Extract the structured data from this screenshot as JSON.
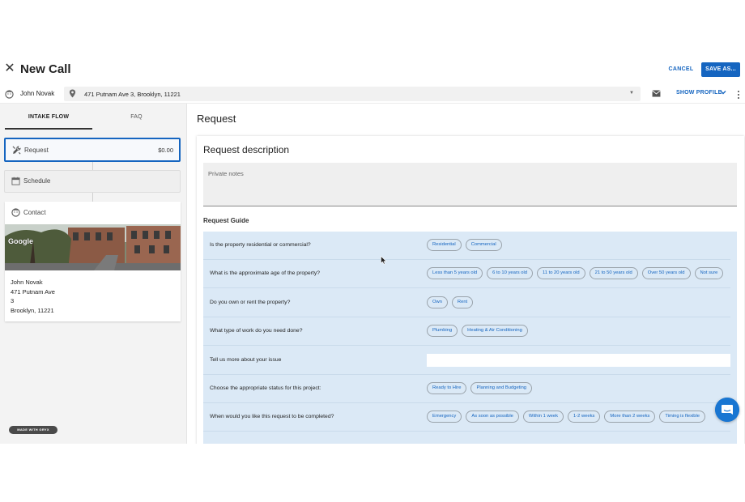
{
  "header": {
    "title": "New Call",
    "cancel_label": "CANCEL",
    "save_label": "SAVE AS..."
  },
  "topbar": {
    "customer_name": "John Novak",
    "address": "471 Putnam Ave 3, Brooklyn, 11221",
    "show_profile_label": "SHOW PROFILE"
  },
  "sidebar": {
    "tabs": [
      "INTAKE FLOW",
      "FAQ"
    ],
    "steps": [
      {
        "label": "Request",
        "amount": "$0.00",
        "icon": "tools-icon"
      },
      {
        "label": "Schedule",
        "icon": "calendar-icon"
      }
    ],
    "contact": {
      "title": "Contact",
      "map_brand": "Google",
      "lines": [
        "John Novak",
        "471 Putnam Ave",
        "3",
        "Brooklyn, 11221"
      ]
    },
    "badge": "MADE WITH GRYX"
  },
  "main": {
    "page_title": "Request",
    "description_title": "Request description",
    "notes_placeholder": "Private notes",
    "guide_title": "Request Guide",
    "questions": [
      {
        "q": "Is the property residential or commercial?",
        "options": [
          "Residential",
          "Commercial"
        ]
      },
      {
        "q": "What is the approximate age of the property?",
        "options": [
          "Less than 5 years old",
          "6 to 10 years old",
          "11 to 20 years old",
          "21 to 50 years old",
          "Over 50 years old",
          "Not sure"
        ]
      },
      {
        "q": "Do you own or rent the property?",
        "options": [
          "Own",
          "Rent"
        ]
      },
      {
        "q": "What type of work do you need done?",
        "options": [
          "Plumbing",
          "Heating & Air Conditioning"
        ]
      },
      {
        "q": "Tell us more about your issue",
        "input": true
      },
      {
        "q": "Choose the appropriate status for this project:",
        "options": [
          "Ready to Hire",
          "Planning and Budgeting"
        ]
      },
      {
        "q": "When would you like this request to be completed?",
        "options": [
          "Emergency",
          "As soon as possible",
          "Within 1 week",
          "1-2 weeks",
          "More than 2 weeks",
          "Timing is flexible"
        ]
      }
    ]
  },
  "colors": {
    "accent": "#1565c0",
    "guide_bg": "#dbe9f6",
    "sidebar_bg": "#f3f3f3"
  }
}
